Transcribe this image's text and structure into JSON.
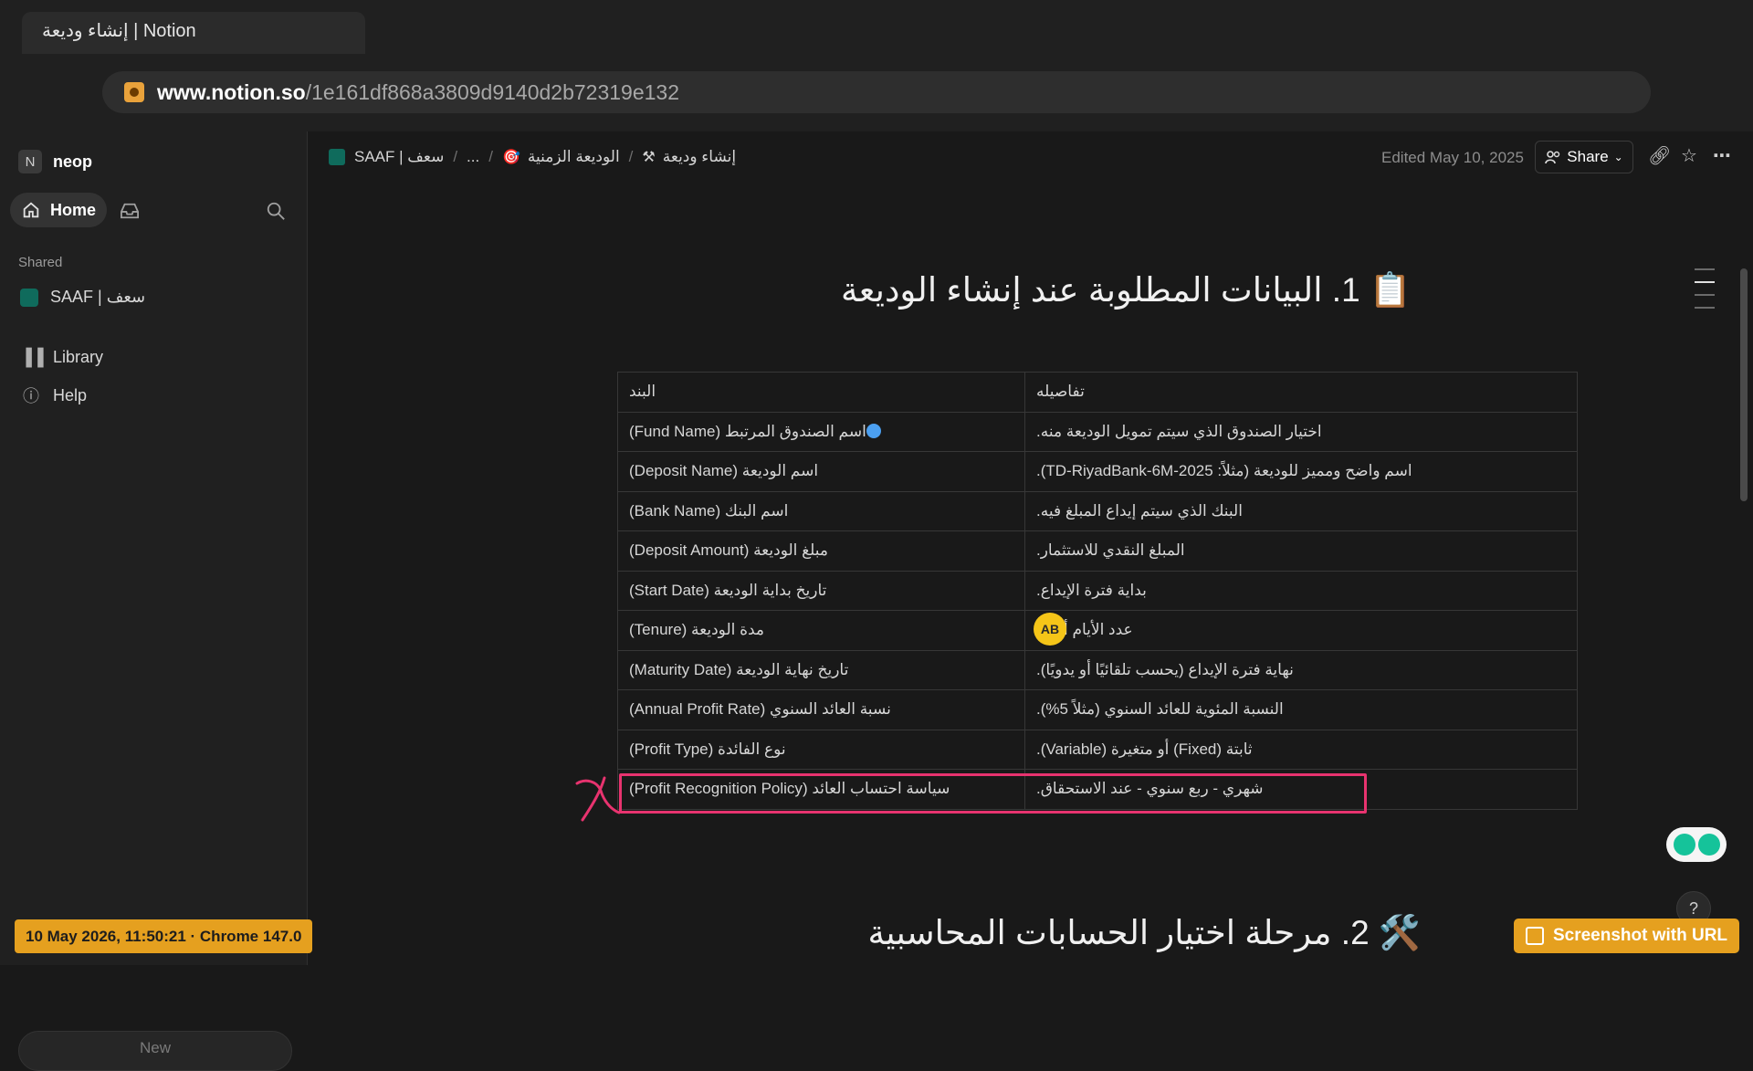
{
  "browser": {
    "tab_title": "إنشاء وديعة | Notion",
    "url_host": "www.notion.so",
    "url_path": "/1e161df868a3809d9140d2b72319e132"
  },
  "sidebar": {
    "workspace_badge": "N",
    "workspace": "neop",
    "home": "Home",
    "shared_label": "Shared",
    "shared_item": "SAAF | سعف",
    "library": "Library",
    "help": "Help",
    "new_button": "New"
  },
  "topbar": {
    "crumb_root": "SAAF | سعف",
    "crumb_ellipsis": "...",
    "crumb_parent": "الوديعة الزمنية",
    "crumb_current": "إنشاء وديعة",
    "edited": "Edited May 10, 2025",
    "share": "Share"
  },
  "page": {
    "heading1": "📋 1. البيانات المطلوبة عند إنشاء الوديعة",
    "heading2": "🛠️ 2. مرحلة اختيار الحسابات المحاسبية",
    "table": {
      "header": [
        "البند",
        "تفاصيله"
      ],
      "rows": [
        [
          "اسم الصندوق المرتبط (Fund Name)",
          "اختيار الصندوق الذي سيتم تمويل الوديعة منه."
        ],
        [
          "اسم الوديعة (Deposit Name)",
          "اسم واضح ومميز للوديعة (مثلاً: TD-RiyadBank-6M-2025)."
        ],
        [
          "اسم البنك (Bank Name)",
          "البنك الذي سيتم إيداع المبلغ فيه."
        ],
        [
          "مبلغ الوديعة (Deposit Amount)",
          "المبلغ النقدي للاستثمار."
        ],
        [
          "تاريخ بداية الوديعة (Start Date)",
          "بداية فترة الإيداع."
        ],
        [
          "مدة الوديعة (Tenure)",
          "عدد الأيام أو ال"
        ],
        [
          "تاريخ نهاية الوديعة (Maturity Date)",
          "نهاية فترة الإيداع (يحسب تلقائيًا أو يدويًا)."
        ],
        [
          "نسبة العائد السنوي (Annual Profit Rate)",
          "النسبة المئوية للعائد السنوي (مثلاً 5%)."
        ],
        [
          "نوع الفائدة (Profit Type)",
          "ثابتة (Fixed) أو متغيرة (Variable)."
        ],
        [
          "سياسة احتساب العائد (Profit Recognition Policy)",
          "شهري - ربع سنوي - عند الاستحقاق."
        ]
      ]
    },
    "avatar": "AB"
  },
  "overlay": {
    "timestamp": "10 May 2026, 11:50:21 · Chrome 147.0",
    "screenshot_button": "Screenshot with URL",
    "help_icon": "?"
  },
  "colors": {
    "highlight": "#e8336f",
    "accent": "#e5a01f"
  }
}
